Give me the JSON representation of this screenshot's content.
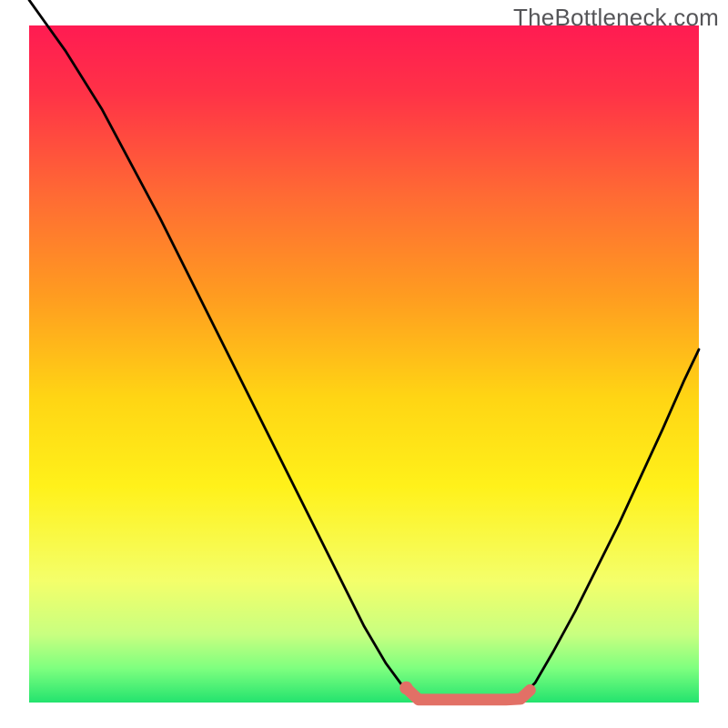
{
  "watermark": "TheBottleneck.com",
  "chart_data": {
    "type": "line",
    "title": "",
    "xlabel": "",
    "ylabel": "",
    "xlim": [
      0,
      100
    ],
    "ylim": [
      0,
      100
    ],
    "gradient_stops": [
      {
        "offset": 0.0,
        "color": "#ff1b52"
      },
      {
        "offset": 0.1,
        "color": "#ff3247"
      },
      {
        "offset": 0.25,
        "color": "#ff6a34"
      },
      {
        "offset": 0.4,
        "color": "#ff9c20"
      },
      {
        "offset": 0.55,
        "color": "#ffd514"
      },
      {
        "offset": 0.68,
        "color": "#fff11a"
      },
      {
        "offset": 0.82,
        "color": "#f4ff6a"
      },
      {
        "offset": 0.9,
        "color": "#c8ff80"
      },
      {
        "offset": 0.95,
        "color": "#7dff7f"
      },
      {
        "offset": 1.0,
        "color": "#23e36e"
      }
    ],
    "gradient_rect": {
      "x": 4,
      "y": 3.5,
      "w": 92,
      "h": 93
    },
    "series": [
      {
        "name": "curve",
        "stroke": "#000000",
        "stroke_width": 0.35,
        "points": [
          {
            "x": 4.0,
            "y": 100.0
          },
          {
            "x": 6.0,
            "y": 97.2
          },
          {
            "x": 9.0,
            "y": 93.0
          },
          {
            "x": 14.0,
            "y": 85.0
          },
          {
            "x": 22.0,
            "y": 70.0
          },
          {
            "x": 30.0,
            "y": 54.0
          },
          {
            "x": 38.0,
            "y": 38.0
          },
          {
            "x": 46.0,
            "y": 22.0
          },
          {
            "x": 50.0,
            "y": 14.0
          },
          {
            "x": 53.0,
            "y": 8.9
          },
          {
            "x": 55.5,
            "y": 5.5
          },
          {
            "x": 57.5,
            "y": 3.8
          },
          {
            "x": 59.5,
            "y": 3.9
          },
          {
            "x": 61.5,
            "y": 3.9
          },
          {
            "x": 63.5,
            "y": 3.9
          },
          {
            "x": 65.5,
            "y": 3.9
          },
          {
            "x": 67.5,
            "y": 3.9
          },
          {
            "x": 69.5,
            "y": 3.9
          },
          {
            "x": 71.5,
            "y": 4.2
          },
          {
            "x": 73.5,
            "y": 6.2
          },
          {
            "x": 76.0,
            "y": 10.5
          },
          {
            "x": 79.0,
            "y": 16.0
          },
          {
            "x": 82.0,
            "y": 22.0
          },
          {
            "x": 85.0,
            "y": 28.0
          },
          {
            "x": 88.0,
            "y": 34.5
          },
          {
            "x": 91.0,
            "y": 41.0
          },
          {
            "x": 94.0,
            "y": 47.8
          },
          {
            "x": 96.0,
            "y": 52.0
          }
        ]
      },
      {
        "name": "highlight",
        "stroke": "#e27066",
        "stroke_width": 1.6,
        "points": [
          {
            "x": 55.8,
            "y": 5.5
          },
          {
            "x": 57.5,
            "y": 3.9
          },
          {
            "x": 59.5,
            "y": 3.9
          },
          {
            "x": 61.5,
            "y": 3.9
          },
          {
            "x": 63.5,
            "y": 3.9
          },
          {
            "x": 65.5,
            "y": 3.9
          },
          {
            "x": 67.5,
            "y": 3.9
          },
          {
            "x": 69.5,
            "y": 3.9
          },
          {
            "x": 71.5,
            "y": 4.0
          },
          {
            "x": 72.8,
            "y": 5.2
          }
        ]
      }
    ],
    "marker": {
      "x": 55.8,
      "y": 5.5,
      "r": 0.9,
      "fill": "#e27066"
    }
  }
}
